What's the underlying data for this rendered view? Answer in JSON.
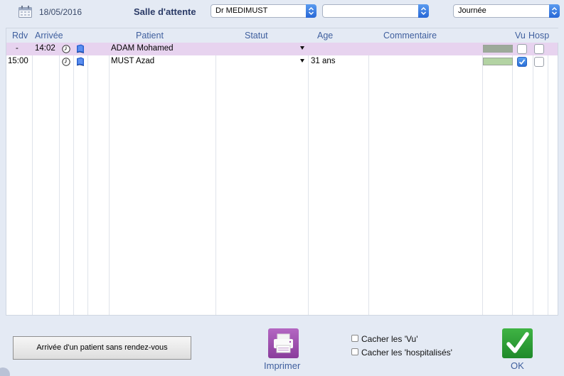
{
  "header": {
    "date": "18/05/2016",
    "title": "Salle d'attente",
    "doctor_select": "Dr MEDIMUST",
    "middle_select": "",
    "period_select": "Journée"
  },
  "columns": {
    "rdv": "Rdv",
    "arrivee": "Arrivée",
    "patient": "Patient",
    "statut": "Statut",
    "age": "Age",
    "commentaire": "Commentaire",
    "vu": "Vu",
    "hosp": "Hosp"
  },
  "rows": [
    {
      "rdv": "-",
      "arrivee": "14:02",
      "patient": "ADAM Mohamed",
      "statut": "",
      "age": "",
      "commentaire": "",
      "bar_color": "#9daa9a",
      "vu": false,
      "hosp": false,
      "selected": true
    },
    {
      "rdv": "15:00",
      "arrivee": "",
      "patient": "MUST Azad",
      "statut": "",
      "age": "31 ans",
      "commentaire": "",
      "bar_color": "#b3d3a3",
      "vu": true,
      "hosp": false,
      "selected": false
    }
  ],
  "footer": {
    "no_appointment_button": "Arrivée d'un patient sans rendez-vous",
    "print_label": "Imprimer",
    "hide_seen_label": "Cacher les 'Vu'",
    "hide_hospitalized_label": "Cacher les 'hospitalisés'",
    "hide_seen_checked": false,
    "hide_hospitalized_checked": false,
    "ok_label": "OK"
  },
  "icons": {
    "calendar": "calendar-icon",
    "clock": "clock-icon",
    "book": "book-icon",
    "printer": "printer-icon",
    "check": "check-icon"
  },
  "colors": {
    "selected_row": "#e7d3ef",
    "accent_blue": "#2a6fd8",
    "print_purple": "#9b4aab",
    "ok_green": "#2a9a33"
  }
}
